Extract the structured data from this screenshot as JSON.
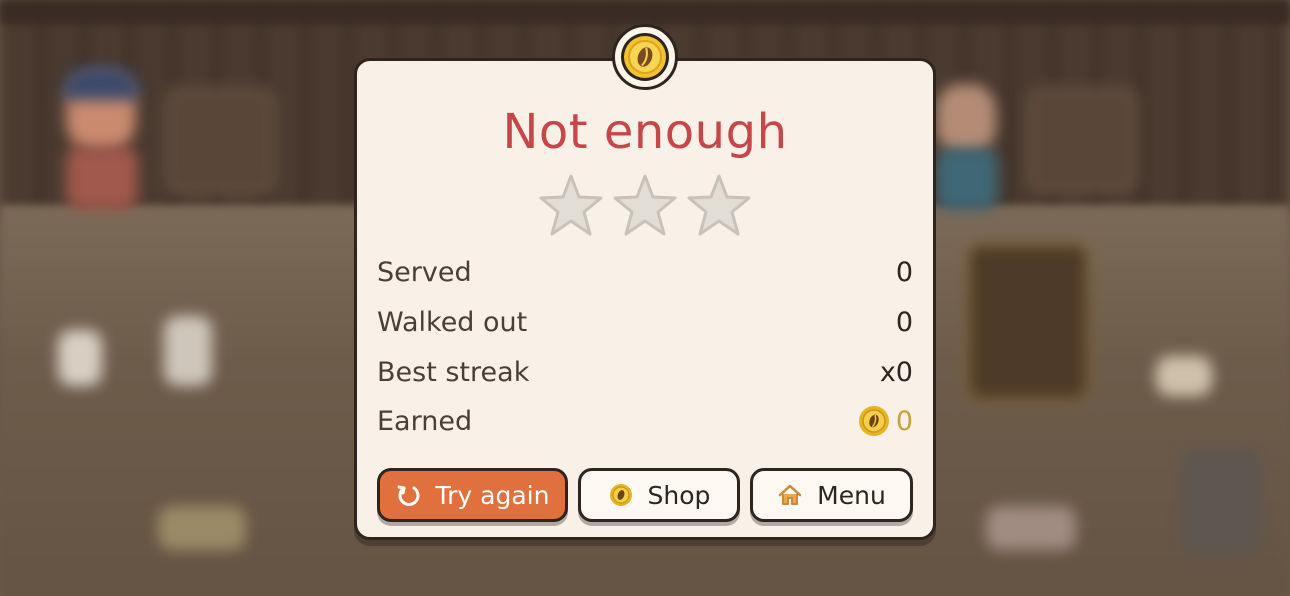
{
  "dialog": {
    "title": "Not enough",
    "stars_earned": 0,
    "stars_total": 3,
    "title_color": "#c6474a",
    "badge_icon": "coffee-bean-coin-icon"
  },
  "stats": [
    {
      "label": "Served",
      "value": "0"
    },
    {
      "label": "Walked out",
      "value": "0"
    },
    {
      "label": "Best streak",
      "value": "x0"
    },
    {
      "label": "Earned",
      "value": "0",
      "icon": "coin-icon"
    }
  ],
  "buttons": {
    "try_again": {
      "label": "Try again",
      "icon": "restart-icon",
      "color": "#e0703e"
    },
    "shop": {
      "label": "Shop",
      "icon": "coin-icon"
    },
    "menu": {
      "label": "Menu",
      "icon": "home-icon"
    }
  }
}
